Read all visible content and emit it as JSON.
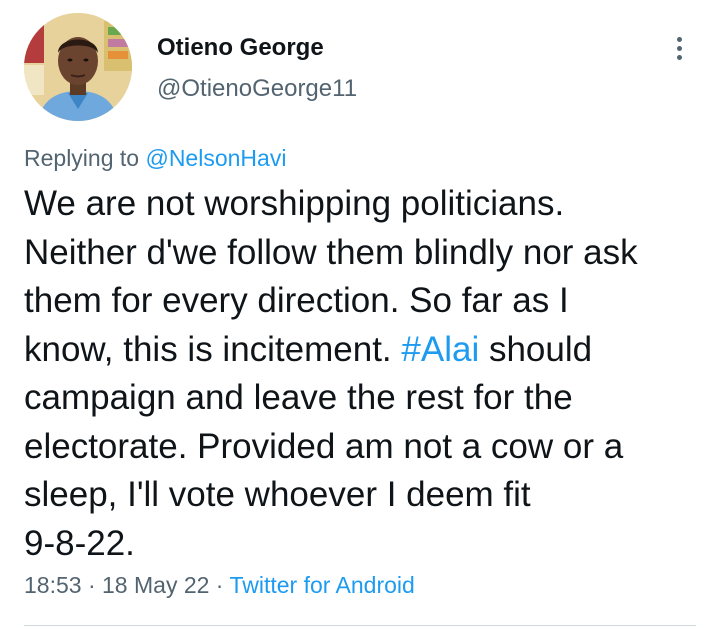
{
  "author": {
    "name": "Otieno George",
    "handle": "@OtienoGeorge11"
  },
  "icons": {
    "more": "more-vertical-icon",
    "avatar": "profile-photo"
  },
  "reply": {
    "prefix": "Replying to ",
    "mention": "@NelsonHavi"
  },
  "tweet": {
    "lines": [
      "We are not worshipping politicians.",
      "Neither d'we follow them blindly nor ask",
      "them for every direction. So far as I",
      "know, this is incitement. ",
      " should",
      "campaign and leave the rest for the",
      "electorate. Provided am not a cow or a",
      "sleep, I'll vote whoever I deem fit",
      "9-8-22."
    ],
    "hashtag": "#Alai"
  },
  "meta": {
    "time": "18:53",
    "sep1": " · ",
    "date": "18 May 22",
    "sep2": " · ",
    "source": "Twitter for Android"
  },
  "colors": {
    "link": "#1d9bf0",
    "secondary_text": "#536471",
    "primary_text": "#0f1419",
    "divider": "#cfd9de"
  }
}
